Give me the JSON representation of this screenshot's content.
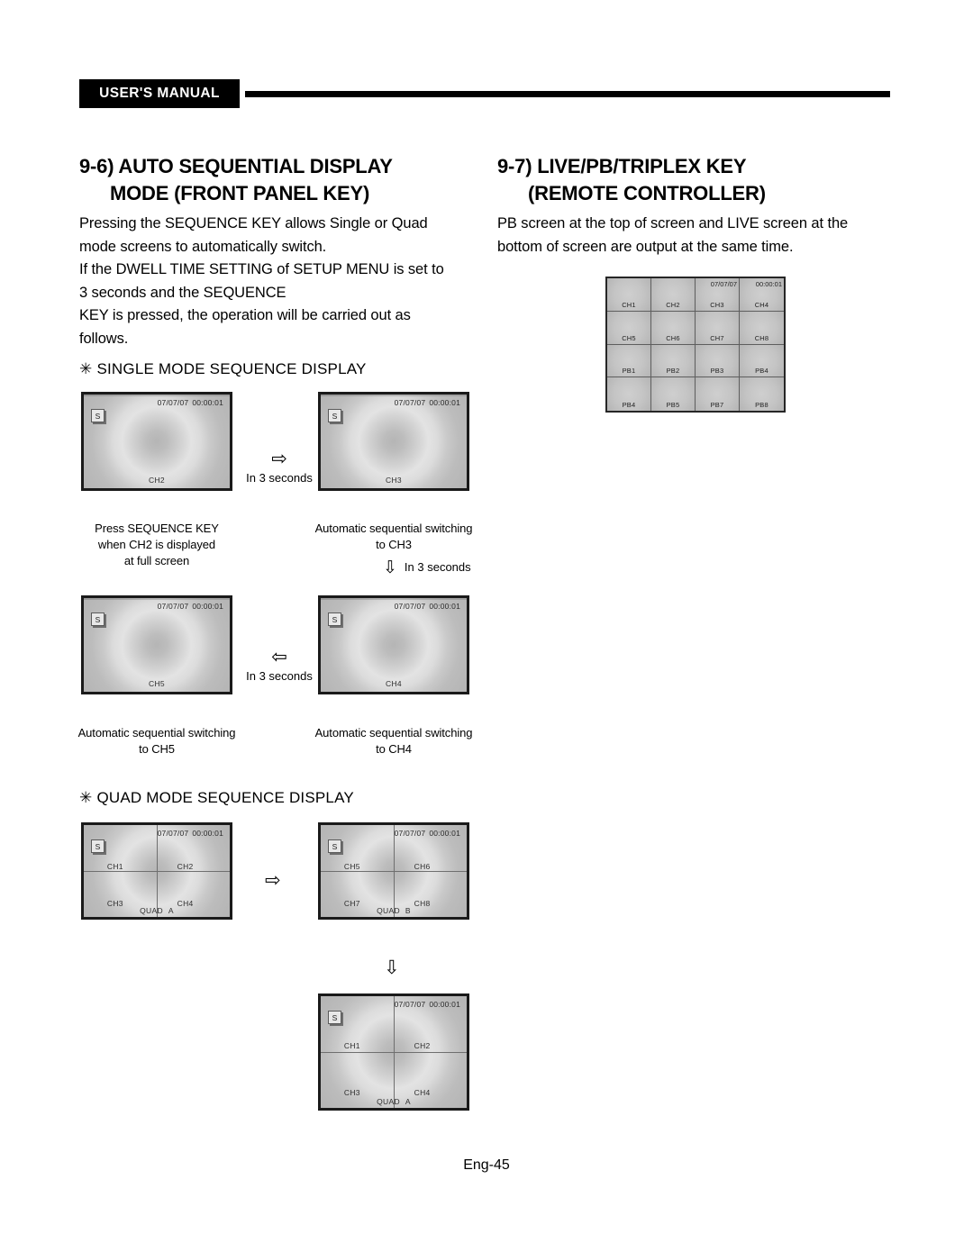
{
  "header": {
    "manual_tag": "USER'S MANUAL"
  },
  "left_column": {
    "title_line1": "9-6) AUTO SEQUENTIAL DISPLAY",
    "title_line2": "MODE (FRONT PANEL KEY)",
    "body_lines": [
      "Pressing the SEQUENCE KEY allows Single or Quad",
      "mode screens to automatically switch.",
      "If the DWELL TIME SETTING of SETUP MENU is set to",
      "3 seconds and the SEQUENCE",
      "KEY is pressed, the operation will be carried out as",
      "follows."
    ],
    "single_mode_heading": "SINGLE MODE SEQUENCE DISPLAY",
    "quad_mode_heading": "QUAD MODE SEQUENCE DISPLAY",
    "heading_bullet": "✳"
  },
  "right_column": {
    "title_line1": "9-7) LIVE/PB/TRIPLEX KEY",
    "title_line2": "(REMOTE CONTROLLER)",
    "body_lines": [
      "PB screen at the top of screen and LIVE screen at the",
      "bottom of screen are output at the same time."
    ]
  },
  "timestamp": {
    "date": "07/07/07",
    "time": "00:00:01"
  },
  "badge": {
    "sequence": "S"
  },
  "single_screens": [
    {
      "name": "single-screen-ch2",
      "channel": "CH2"
    },
    {
      "name": "single-screen-ch3",
      "channel": "CH3"
    },
    {
      "name": "single-screen-ch5",
      "channel": "CH5"
    },
    {
      "name": "single-screen-ch4",
      "channel": "CH4"
    }
  ],
  "single_captions": [
    {
      "lines": [
        "Press SEQUENCE KEY",
        "when CH2 is displayed",
        "at full screen"
      ]
    },
    {
      "lines": [
        "Automatic sequential switching",
        "to CH3"
      ]
    },
    {
      "lines": [
        "Automatic sequential switching",
        "to CH5"
      ]
    },
    {
      "lines": [
        "Automatic sequential switching",
        "to CH4"
      ]
    }
  ],
  "arrows": {
    "right_glyph": "⇨",
    "left_glyph": "⇦",
    "down_glyph": "⇩",
    "dwell_label": "In 3 seconds"
  },
  "quad_screens": [
    {
      "name": "quad-screen-a-top",
      "mode_prefix": "QUAD",
      "mode_letter": "A",
      "cells": [
        "CH1",
        "CH2",
        "CH3",
        "CH4"
      ]
    },
    {
      "name": "quad-screen-b",
      "mode_prefix": "QUAD",
      "mode_letter": "B",
      "cells": [
        "CH5",
        "CH6",
        "CH7",
        "CH8"
      ]
    },
    {
      "name": "quad-screen-a-bottom",
      "mode_prefix": "QUAD",
      "mode_letter": "A",
      "cells": [
        "CH1",
        "CH2",
        "CH3",
        "CH4"
      ]
    }
  ],
  "triplex_matrix": {
    "rows": [
      [
        "CH1",
        "CH2",
        "CH3",
        "CH4"
      ],
      [
        "CH5",
        "CH6",
        "CH7",
        "CH8"
      ],
      [
        "PB1",
        "PB2",
        "PB3",
        "PB4"
      ],
      [
        "PB4",
        "PB5",
        "PB7",
        "PB8"
      ]
    ],
    "stamp_date_cell": "07/07/07",
    "stamp_time_cell": "00:00:01"
  },
  "footer": {
    "page_label": "Eng-45"
  }
}
